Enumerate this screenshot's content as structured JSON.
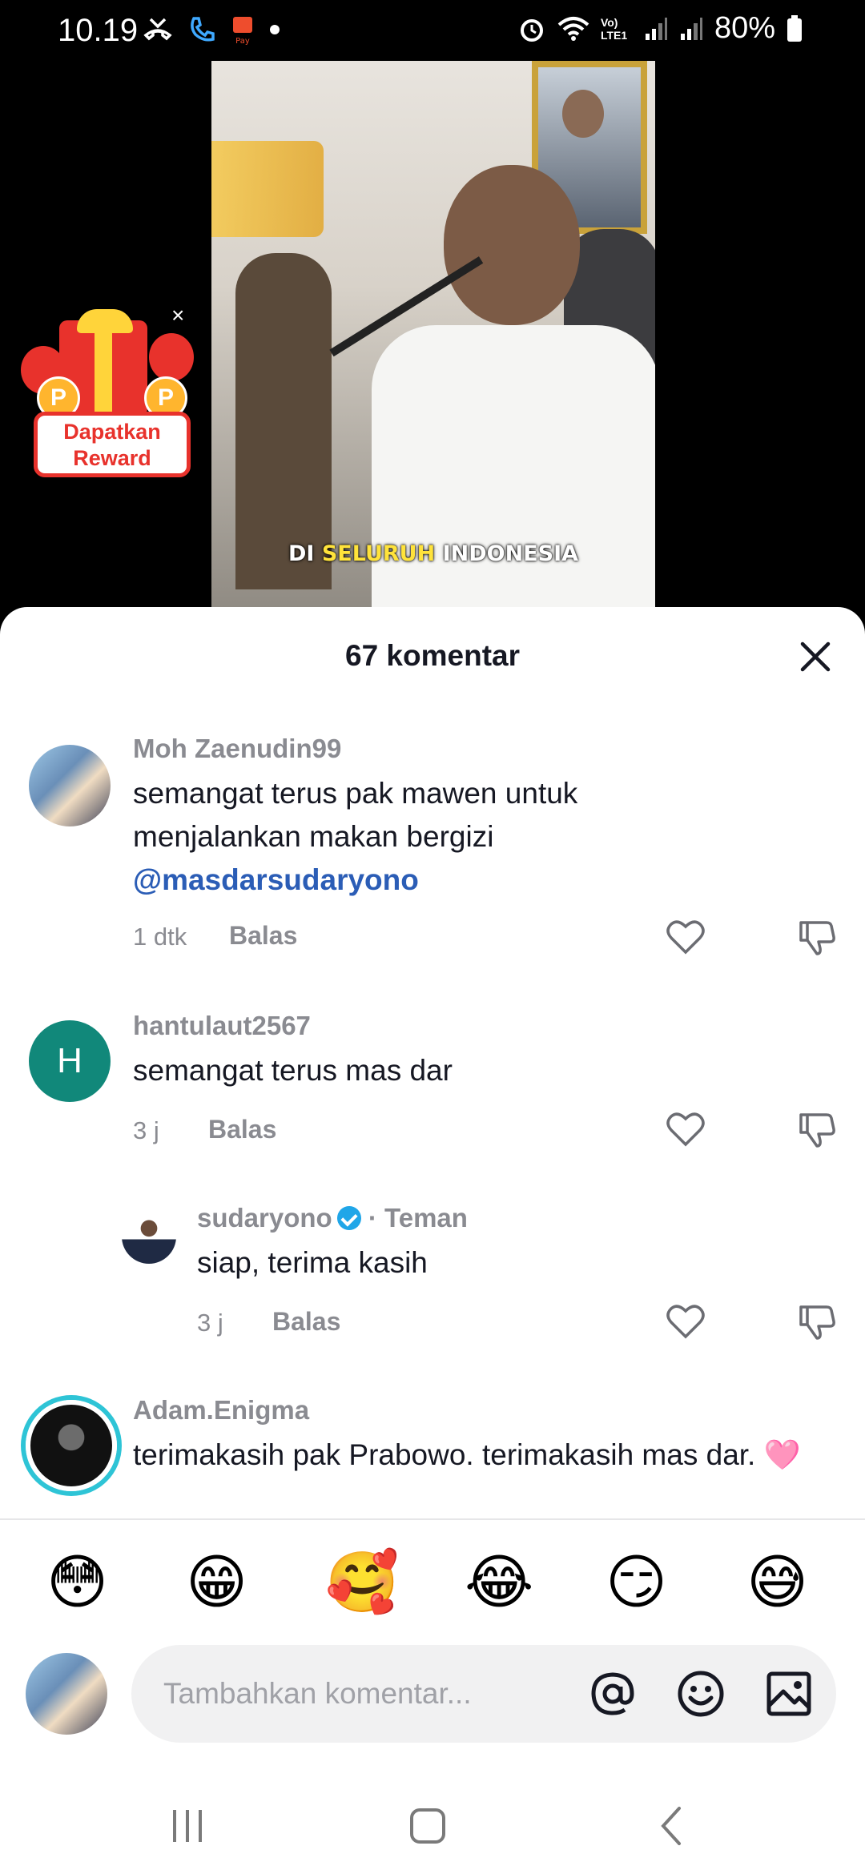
{
  "status_bar": {
    "time": "10.19",
    "net_label": "Vo) LTE1",
    "battery": "80%"
  },
  "video": {
    "caption_part1": "DI ",
    "caption_highlight": "SELURUH",
    "caption_part2": " INDONESIA"
  },
  "reward": {
    "line1": "Dapatkan",
    "line2": "Reward",
    "coin_letter": "P",
    "close": "×"
  },
  "sheet": {
    "title": "67 komentar"
  },
  "comments": [
    {
      "user": "Moh Zaenudin99",
      "text": "semangat terus pak mawen untuk menjalankan makan bergizi",
      "mention": "@masdarsudaryono",
      "time": "1 dtk",
      "reply": "Balas"
    },
    {
      "user": "hantulaut2567",
      "avatar_letter": "H",
      "text": "semangat terus mas dar",
      "time": "3 j",
      "reply": "Balas"
    },
    {
      "user": "sudaryono",
      "badge": "· Teman",
      "text": "siap, terima kasih",
      "time": "3 j",
      "reply": "Balas"
    },
    {
      "user": "Adam.Enigma",
      "text": "terimakasih pak Prabowo. terimakasih mas dar. 🩷"
    }
  ],
  "emojis": [
    "😳",
    "😁",
    "🥰",
    "😂",
    "😏",
    "😅"
  ],
  "composer": {
    "placeholder": "Tambahkan komentar..."
  },
  "icons": {
    "close": "close-icon",
    "heart": "heart-icon",
    "dislike": "dislike-icon",
    "mention": "at-icon",
    "emoji": "emoji-icon",
    "image": "image-icon"
  },
  "colors": {
    "mention": "#2b5db6",
    "avatar_h": "#11887a",
    "verified": "#20a6e8",
    "reward_red": "#e8322c"
  }
}
